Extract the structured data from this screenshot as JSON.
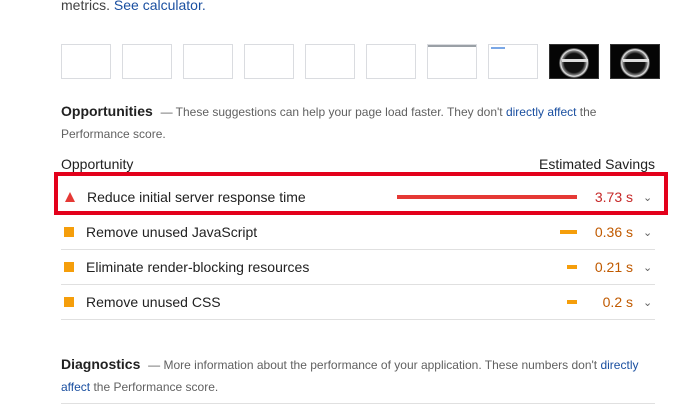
{
  "top": {
    "prefix": "metrics. ",
    "link": "See calculator."
  },
  "filmstrip": {
    "frames": [
      {
        "kind": "blank"
      },
      {
        "kind": "blank"
      },
      {
        "kind": "blank"
      },
      {
        "kind": "blank"
      },
      {
        "kind": "blank"
      },
      {
        "kind": "blank"
      },
      {
        "kind": "loading"
      },
      {
        "kind": "loading2"
      },
      {
        "kind": "dark"
      },
      {
        "kind": "dark"
      }
    ]
  },
  "opportunities": {
    "title": "Opportunities",
    "desc_prefix": "— These suggestions can help your page load faster. They don't ",
    "desc_link": "directly affect",
    "desc_suffix": " the",
    "desc_line2": "Performance score.",
    "col_left": "Opportunity",
    "col_right": "Estimated Savings",
    "items": [
      {
        "label": "Reduce initial server response time",
        "value": "3.73 s",
        "severity": "fail",
        "bar_fraction": 1.0,
        "bar_color": "#e53935"
      },
      {
        "label": "Remove unused JavaScript",
        "value": "0.36 s",
        "severity": "average",
        "bar_fraction": 0.096,
        "bar_color": "#f59e0b"
      },
      {
        "label": "Eliminate render-blocking resources",
        "value": "0.21 s",
        "severity": "average",
        "bar_fraction": 0.056,
        "bar_color": "#f59e0b"
      },
      {
        "label": "Remove unused CSS",
        "value": "0.2 s",
        "severity": "average",
        "bar_fraction": 0.054,
        "bar_color": "#f59e0b"
      }
    ]
  },
  "diagnostics": {
    "title": "Diagnostics",
    "desc_prefix": "— More information about the performance of your application. These numbers don't ",
    "desc_link": "directly",
    "desc_line2_link": "affect",
    "desc_line2_suffix": " the Performance score."
  },
  "icons": {
    "fail": "triangle-icon",
    "average": "square-icon",
    "expand": "chevron-down-icon"
  },
  "colors": {
    "fail": "#e53935",
    "average": "#f59e0b",
    "highlight": "#e3001b",
    "link": "#1a4fa0"
  }
}
